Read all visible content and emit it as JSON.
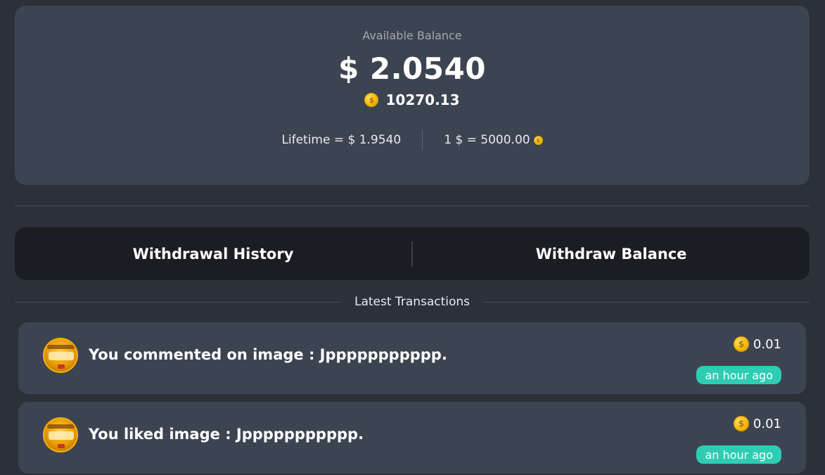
{
  "balance": {
    "label": "Available Balance",
    "amount": "$ 2.0540",
    "coins": "10270.13",
    "lifetime": "Lifetime = $ 1.9540",
    "rate": "1 $ = 5000.00"
  },
  "actions": {
    "history_label": "Withdrawal History",
    "withdraw_label": "Withdraw Balance"
  },
  "transactions": {
    "title": "Latest Transactions",
    "items": [
      {
        "text": "You commented on image : Jppppppppppp.",
        "amount": "0.01",
        "time": "an hour ago"
      },
      {
        "text": "You liked image : Jppppppppppp.",
        "amount": "0.01",
        "time": "an hour ago"
      }
    ]
  },
  "icons": {
    "coin": "coin-icon",
    "avatar": "user-avatar"
  },
  "colors": {
    "badge": "#2ecdb3",
    "coin": "#f2b705",
    "card": "#3d4451",
    "background": "#2b3039"
  }
}
